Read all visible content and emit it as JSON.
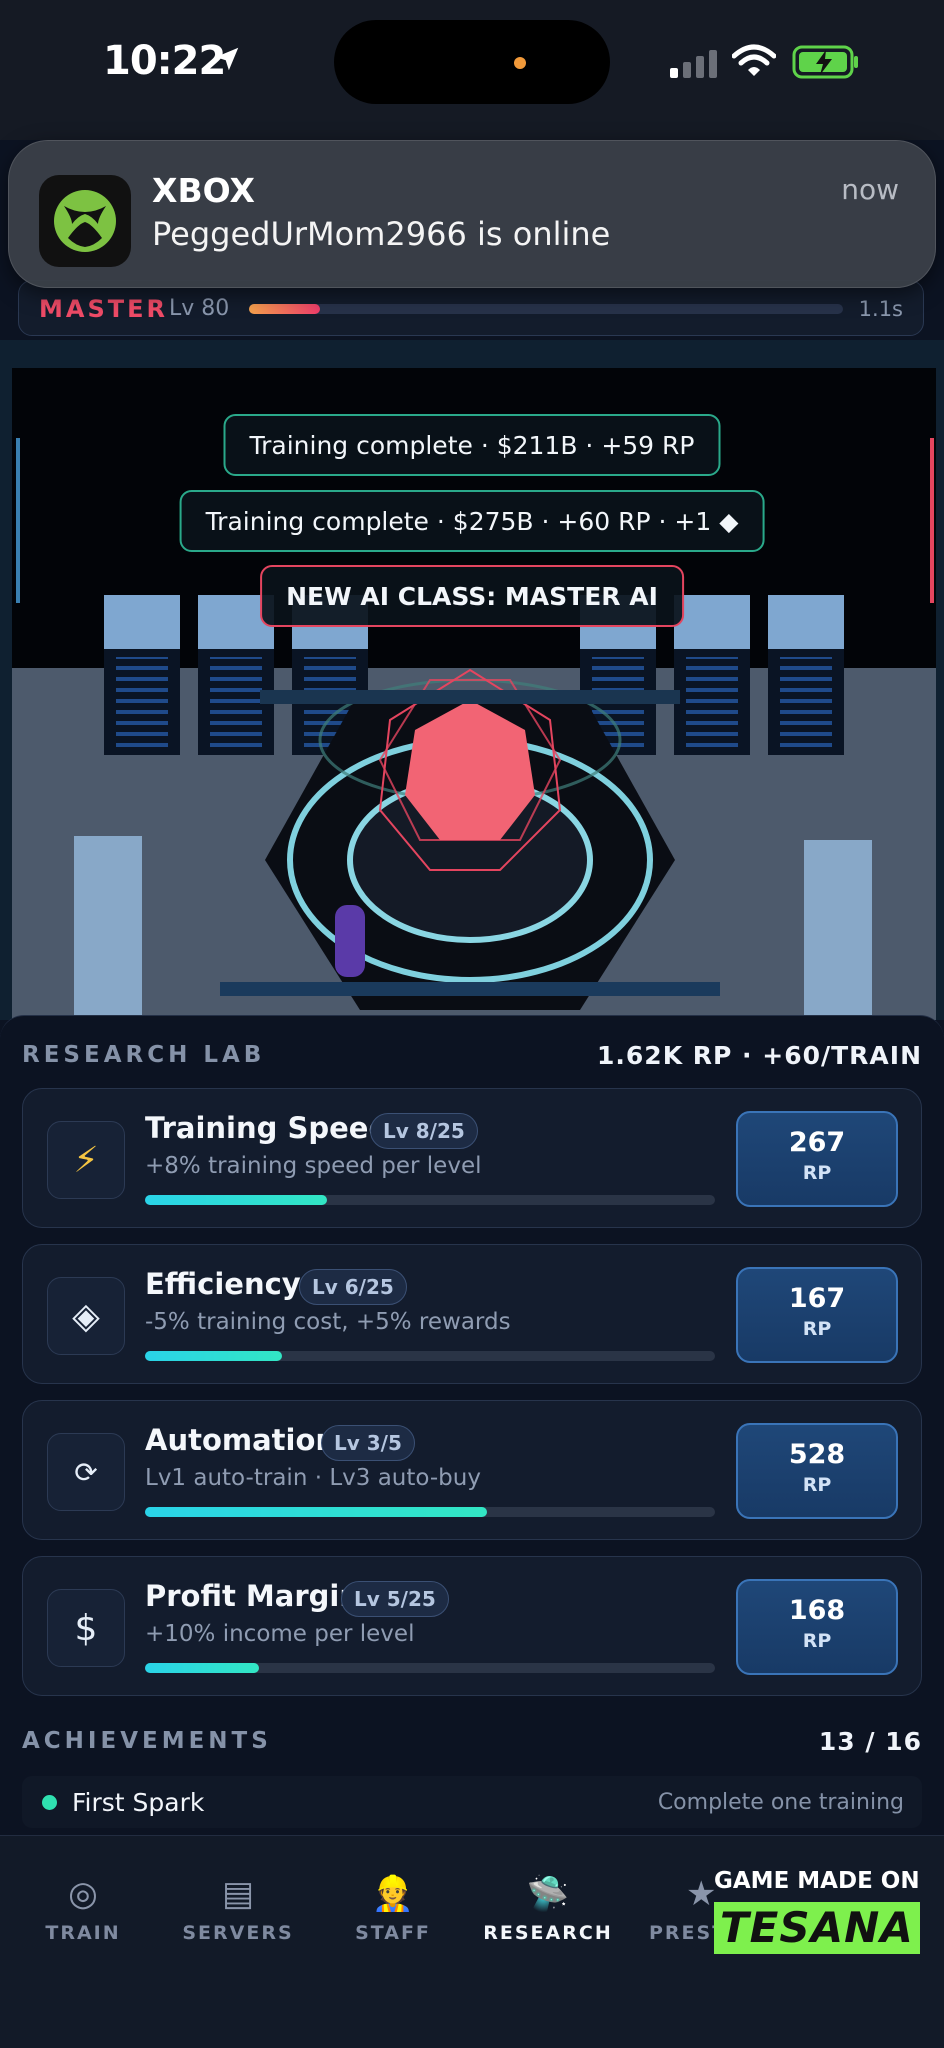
{
  "status_bar": {
    "time": "10:22"
  },
  "notification": {
    "app": "XBOX",
    "message": "PeggedUrMom2966 is online",
    "time": "now"
  },
  "master_bar": {
    "rank": "MASTER",
    "level": "Lv 80",
    "progress": 0.12,
    "timer": "1.1s"
  },
  "scene": {
    "toasts": [
      "Training complete · $211B · +59 RP",
      "Training complete · $275B · +60 RP · +1 ◆",
      "NEW AI CLASS: MASTER AI"
    ]
  },
  "research": {
    "title": "RESEARCH LAB",
    "summary": "1.62K RP · +60/TRAIN",
    "upgrades": [
      {
        "icon": "lightning-icon",
        "glyph": "⚡",
        "name": "Training Speed",
        "level": "Lv 8/25",
        "desc": "+8% training speed per level",
        "progress": 0.32,
        "cost": "267",
        "unit": "RP"
      },
      {
        "icon": "diamond-icon",
        "glyph": "◈",
        "name": "Efficiency",
        "level": "Lv 6/25",
        "desc": "-5% training cost, +5% rewards",
        "progress": 0.24,
        "cost": "167",
        "unit": "RP"
      },
      {
        "icon": "refresh-icon",
        "glyph": "⟳",
        "name": "Automation",
        "level": "Lv 3/5",
        "desc": "Lv1 auto-train · Lv3 auto-buy",
        "progress": 0.6,
        "cost": "528",
        "unit": "RP"
      },
      {
        "icon": "dollar-icon",
        "glyph": "$",
        "name": "Profit Margin",
        "level": "Lv 5/25",
        "desc": "+10% income per level",
        "progress": 0.2,
        "cost": "168",
        "unit": "RP"
      }
    ]
  },
  "achievements": {
    "title": "ACHIEVEMENTS",
    "count": "13 / 16",
    "items": [
      {
        "name": "First Spark",
        "desc": "Complete one training"
      }
    ]
  },
  "tabs": [
    {
      "label": "TRAIN",
      "icon": "target-icon",
      "glyph": "◎",
      "active": false
    },
    {
      "label": "SERVERS",
      "icon": "server-icon",
      "glyph": "▤",
      "active": false
    },
    {
      "label": "STAFF",
      "icon": "worker-icon",
      "glyph": "👷",
      "active": false
    },
    {
      "label": "RESEARCH",
      "icon": "research-icon",
      "glyph": "🛸",
      "active": true
    },
    {
      "label": "PREST",
      "icon": "star-icon",
      "glyph": "★",
      "active": false
    }
  ],
  "badge": {
    "top": "GAME MADE ON",
    "brand": "TESANA"
  }
}
